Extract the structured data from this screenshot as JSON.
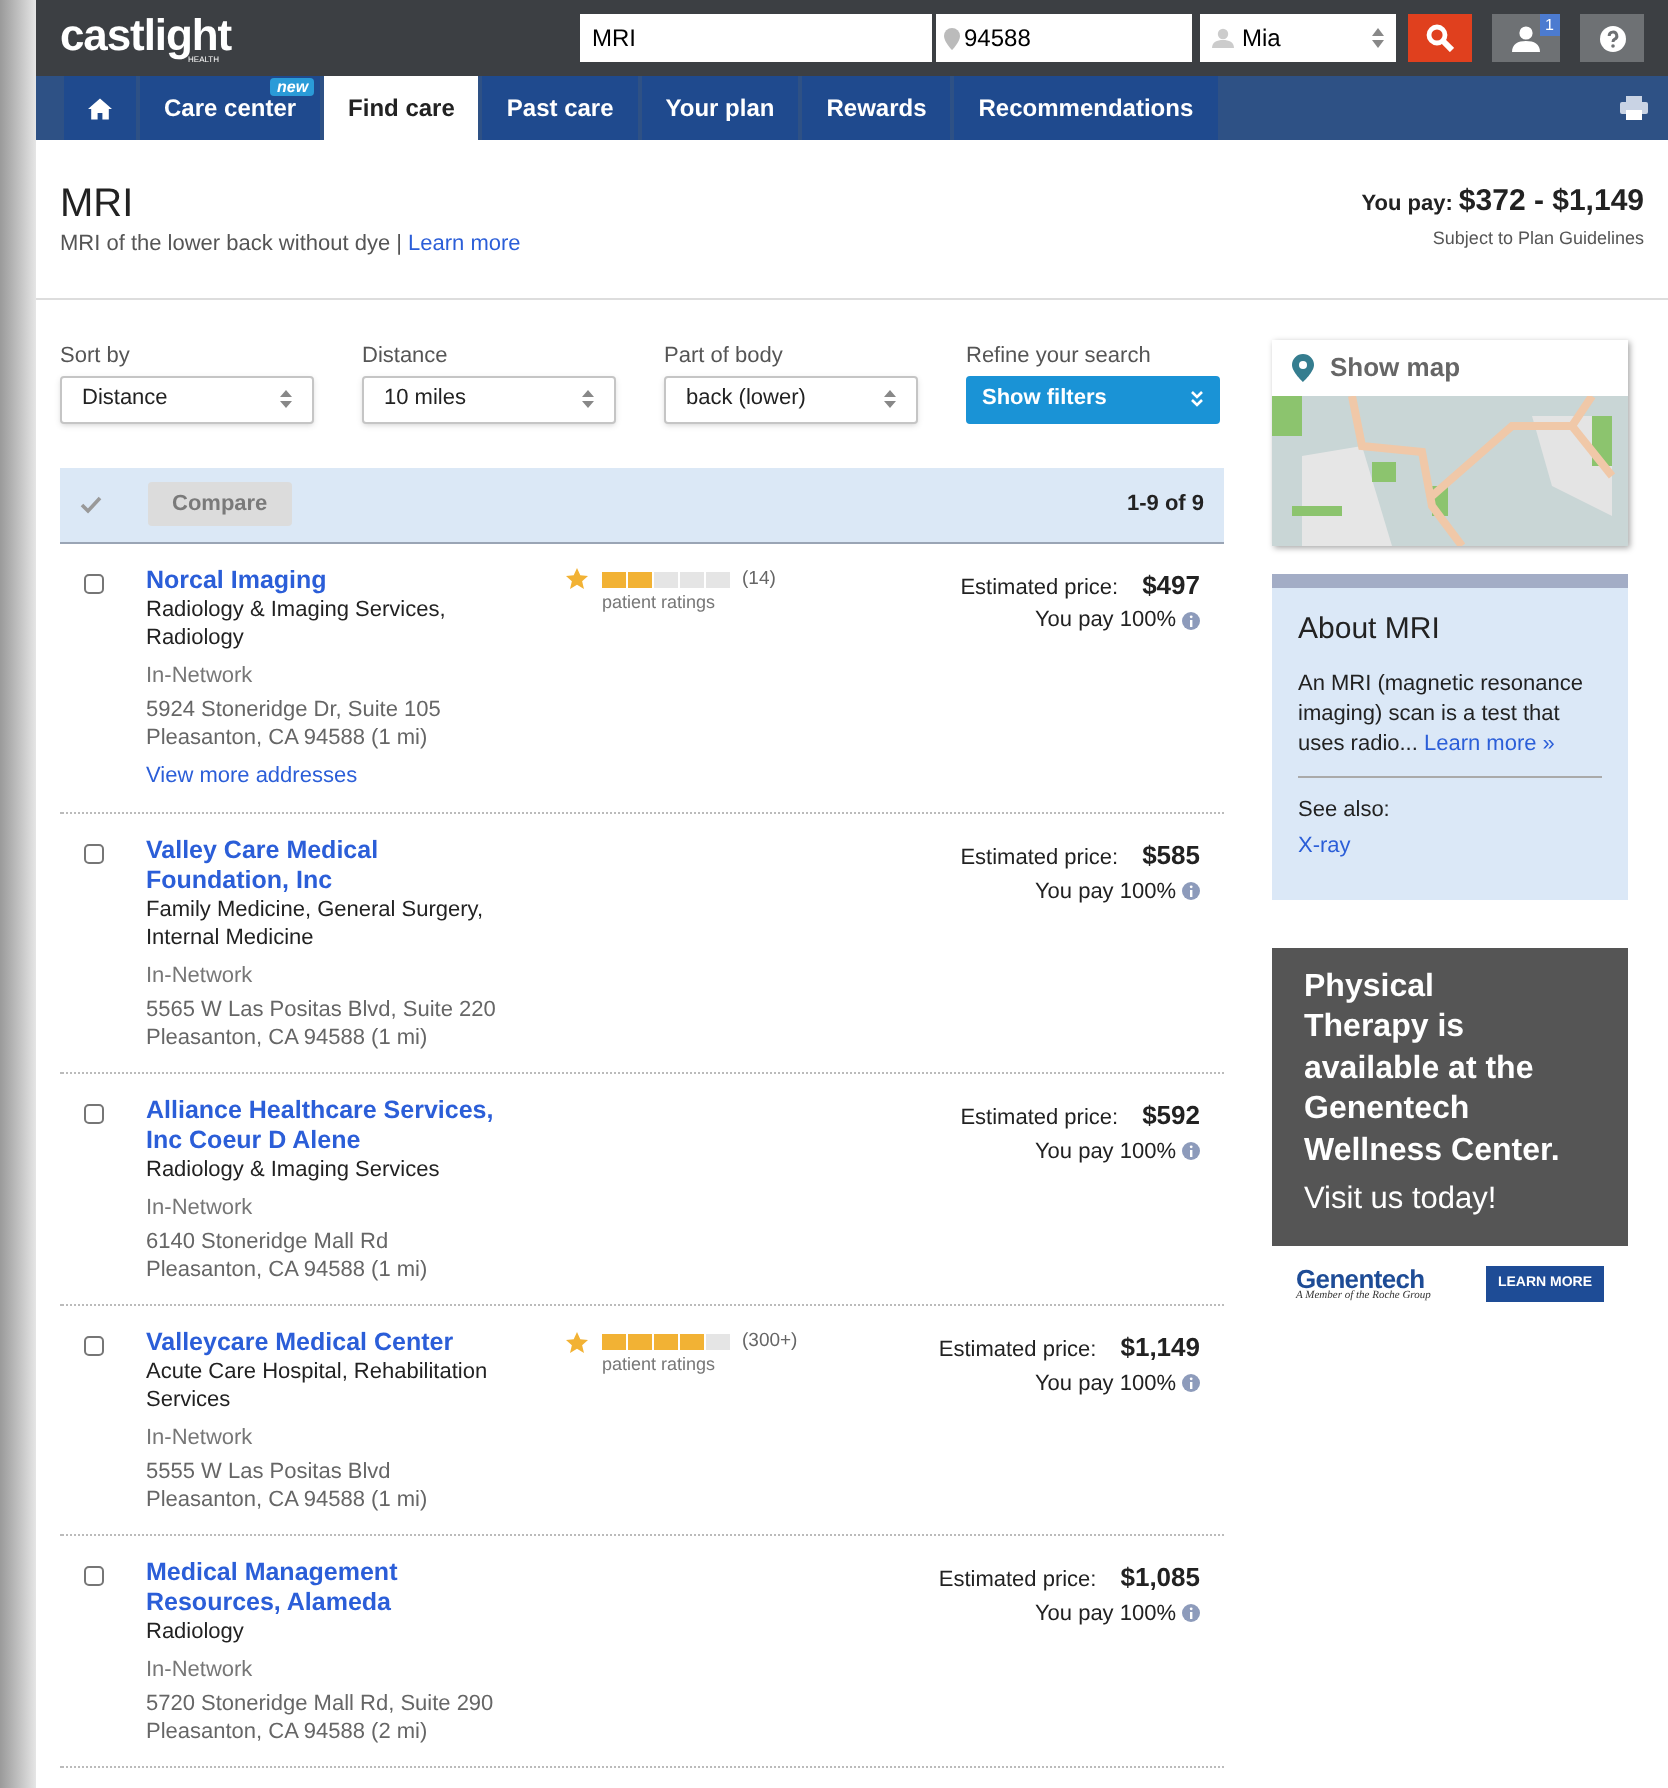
{
  "header": {
    "logo": "castlight",
    "logo_sub": "HEALTH",
    "search": {
      "value": "MRI"
    },
    "location": {
      "value": "94588"
    },
    "user": {
      "value": "Mia"
    },
    "notifications": "1"
  },
  "nav": {
    "tabs": [
      {
        "kind": "home",
        "selected": false
      },
      {
        "kind": "text",
        "label": "Care center",
        "badge": "new",
        "selected": false
      },
      {
        "kind": "text",
        "label": "Find care",
        "selected": true
      },
      {
        "kind": "text",
        "label": "Past care",
        "selected": false
      },
      {
        "kind": "text",
        "label": "Your plan",
        "selected": false
      },
      {
        "kind": "text",
        "label": "Rewards",
        "selected": false
      },
      {
        "kind": "text",
        "label": "Recommendations",
        "selected": false
      }
    ]
  },
  "title": {
    "heading": "MRI",
    "subtitle": "MRI of the lower back without dye |",
    "link": "Learn more",
    "pay_label": "You pay:",
    "pay_range": "$372 - $1,149",
    "pay_note": "Subject to Plan Guidelines"
  },
  "filters": [
    {
      "kind": "select",
      "label": "Sort by",
      "value": "Distance"
    },
    {
      "kind": "select",
      "label": "Distance",
      "value": "10 miles"
    },
    {
      "kind": "select",
      "label": "Part of body",
      "value": "back (lower)"
    },
    {
      "kind": "button",
      "label": "Refine your search",
      "value": "Show filters"
    }
  ],
  "results_bar": {
    "compare": "Compare",
    "compare_disabled": true,
    "count": "1-9 of 9"
  },
  "results": [
    {
      "checked": false,
      "name": [
        "Norcal Imaging"
      ],
      "specialty": [
        "Radiology & Imaging Services,",
        "Radiology"
      ],
      "network": "In-Network",
      "address": [
        "5924 Stoneridge Dr, Suite 105",
        "Pleasanton, CA 94588 (1 mi)"
      ],
      "more": "View more addresses",
      "rating": {
        "stars": 2,
        "count": "(14)",
        "caption": "patient ratings"
      },
      "price_label": "Estimated price:",
      "price": "$497",
      "pay": "You pay 100%"
    },
    {
      "checked": false,
      "name": [
        "Valley Care Medical",
        "Foundation, Inc"
      ],
      "specialty": [
        "Family Medicine, General Surgery,",
        "Internal Medicine"
      ],
      "network": "In-Network",
      "address": [
        "5565 W Las Positas Blvd, Suite 220",
        "Pleasanton, CA 94588 (1 mi)"
      ],
      "price_label": "Estimated price:",
      "price": "$585",
      "pay": "You pay 100%"
    },
    {
      "checked": false,
      "name": [
        "Alliance Healthcare Services,",
        "Inc Coeur D Alene"
      ],
      "specialty": [
        "Radiology & Imaging Services"
      ],
      "network": "In-Network",
      "address": [
        "6140 Stoneridge Mall Rd",
        "Pleasanton, CA 94588 (1 mi)"
      ],
      "price_label": "Estimated price:",
      "price": "$592",
      "pay": "You pay 100%"
    },
    {
      "checked": false,
      "name": [
        "Valleycare Medical Center"
      ],
      "specialty": [
        "Acute Care Hospital, Rehabilitation",
        "Services"
      ],
      "network": "In-Network",
      "address": [
        "5555 W Las Positas Blvd",
        "Pleasanton, CA 94588 (1 mi)"
      ],
      "rating": {
        "stars": 4,
        "count": "(300+)",
        "caption": "patient ratings"
      },
      "price_label": "Estimated price:",
      "price": "$1,149",
      "pay": "You pay 100%"
    },
    {
      "checked": false,
      "name": [
        "Medical Management",
        "Resources, Alameda"
      ],
      "specialty": [
        "Radiology"
      ],
      "network": "In-Network",
      "address": [
        "5720 Stoneridge Mall Rd, Suite 290",
        "Pleasanton, CA 94588 (2 mi)"
      ],
      "price_label": "Estimated price:",
      "price": "$1,085",
      "pay": "You pay 100%"
    }
  ],
  "sidebar": {
    "map_label": "Show map",
    "about": {
      "title": "About MRI",
      "text": "An MRI (magnetic resonance imaging) scan is a test that uses radio...",
      "link": "Learn more »",
      "see_also": "See also:",
      "related": "X-ray"
    },
    "ad": {
      "lines": [
        "Physical",
        "Therapy is",
        "available at the",
        "Genentech",
        "Wellness Center."
      ],
      "cta_text": "Visit us today!",
      "brand": "Genentech",
      "brand_sub": "A Member of the Roche Group",
      "button": "LEARN MORE"
    }
  }
}
